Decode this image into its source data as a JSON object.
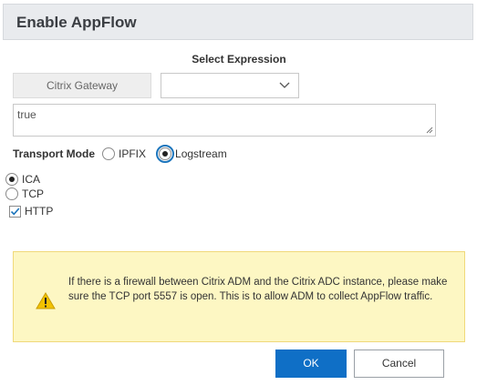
{
  "dialog": {
    "title": "Enable AppFlow"
  },
  "expression": {
    "label": "Select Expression",
    "source": "Citrix Gateway",
    "selected": "",
    "value": "true"
  },
  "transport": {
    "label": "Transport Mode",
    "options": [
      {
        "label": "IPFIX",
        "checked": false
      },
      {
        "label": "Logstream",
        "checked": true
      }
    ]
  },
  "protocols": {
    "radios": [
      {
        "label": "ICA",
        "checked": true
      },
      {
        "label": "TCP",
        "checked": false
      }
    ],
    "http": {
      "label": "HTTP",
      "checked": true
    }
  },
  "warning": {
    "text": "If there is a firewall between Citrix ADM and the Citrix ADC instance, please make sure the TCP port 5557 is open. This is to allow ADM to collect AppFlow traffic."
  },
  "buttons": {
    "ok": "OK",
    "cancel": "Cancel"
  },
  "colors": {
    "primary": "#0f6fc6",
    "warning_bg": "#fdf7c3",
    "warning_icon": "#f2c200",
    "header_bg": "#e9ebee",
    "check": "#1c75bc"
  }
}
